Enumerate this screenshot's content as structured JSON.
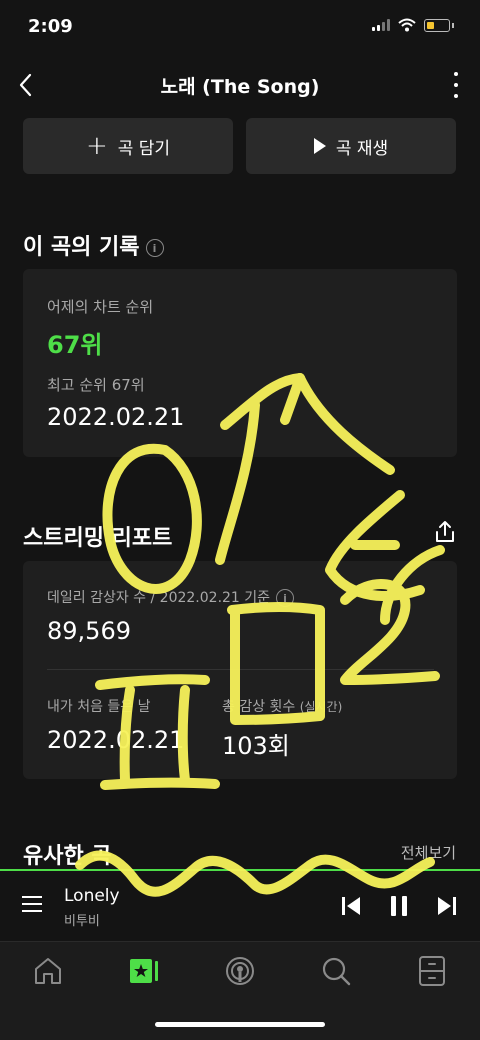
{
  "status": {
    "time": "2:09"
  },
  "header": {
    "title": "노래 (The Song)"
  },
  "actions": {
    "add_label": "곡 담기",
    "play_label": "곡 재생"
  },
  "record": {
    "title": "이 곡의 기록",
    "yesterday_label": "어제의 차트 순위",
    "yesterday_value": "67위",
    "best_label": "최고 순위 67위",
    "best_date": "2022.02.21"
  },
  "streaming": {
    "title": "스트리밍 리포트",
    "daily_label": "데일리 감상자 수 / 2022.02.21 기준",
    "daily_value": "89,569",
    "first_label": "내가 처음 들은 날",
    "first_value": "2022.02.21",
    "plays_label": "총 감상 횟수",
    "plays_suffix": "(실시간)",
    "plays_value": "103회"
  },
  "similar": {
    "title": "유사한 곡",
    "see_all": "전체보기"
  },
  "player": {
    "song": "Lonely",
    "artist": "비투비"
  },
  "colors": {
    "accent": "#4ede48",
    "background": "#141414",
    "card": "#1f1f1f",
    "scribble": "#f7f25a"
  },
  "tabs": [
    "home-icon",
    "my-library-icon",
    "podcast-icon",
    "search-icon",
    "storage-icon"
  ]
}
